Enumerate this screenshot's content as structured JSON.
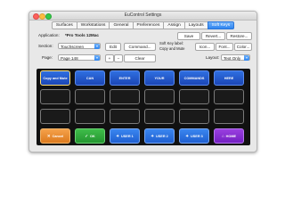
{
  "window": {
    "title": "EuControl Settings"
  },
  "tabs": [
    "Surfaces",
    "Workstations",
    "General",
    "Preferences",
    "Assign",
    "Layouts",
    "Soft Keys"
  ],
  "active_tab": "Soft Keys",
  "application": {
    "label": "Application:",
    "value": "*Pro Tools 12Mac"
  },
  "section": {
    "label": "Section:",
    "value": "Touchscreen"
  },
  "page": {
    "label": "Page:",
    "value": "Page 148"
  },
  "buttons": {
    "save": "Save",
    "revert": "Revert...",
    "restore": "Restore...",
    "edit": "Edit",
    "command": "Command...",
    "clear": "Clear",
    "plus": "+",
    "minus": "−",
    "icon": "Icon...",
    "font": "Font...",
    "color": "Color..."
  },
  "softkey_label": {
    "label": "Soft Key label:",
    "value": "Copy and Mute"
  },
  "layout": {
    "label": "Layout:",
    "value": "Text Only"
  },
  "keys_row1": [
    "Copy and Mute",
    "CAN",
    "ENTER",
    "YOUR",
    "COMMANDS",
    "HERE"
  ],
  "keys_bottom": [
    {
      "label": "Cancel",
      "icon": "✕"
    },
    {
      "label": "OK",
      "icon": "✓"
    },
    {
      "label": "USER 1",
      "icon": "✦"
    },
    {
      "label": "USER 2",
      "icon": "✦"
    },
    {
      "label": "USER 3",
      "icon": "✦"
    },
    {
      "label": "HOME",
      "icon": "⌂"
    }
  ],
  "colors": {
    "accent": "#2f85f0",
    "key_blue": "#1b46b6",
    "cancel": "#dc7a1e",
    "ok": "#249530",
    "home": "#7320c2"
  }
}
